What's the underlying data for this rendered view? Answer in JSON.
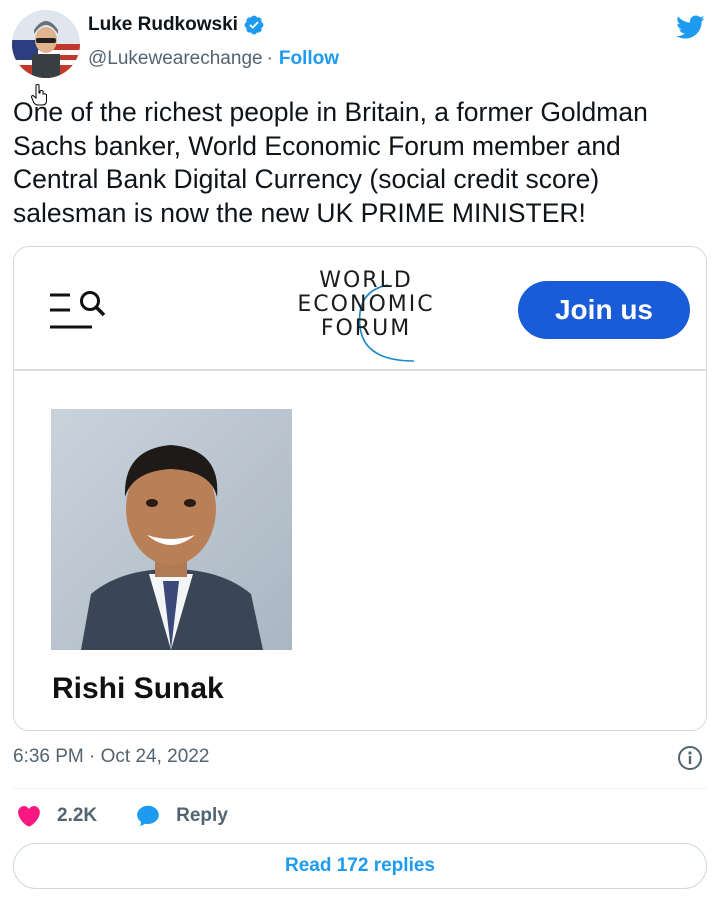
{
  "author": {
    "name": "Luke Rudkowski",
    "handle": "@Lukewearechange",
    "separator": "·",
    "follow_label": "Follow"
  },
  "tweet": {
    "text": "One of the richest people in Britain, a former Goldman Sachs banker, World Economic Forum member and Central Bank Digital Currency (social credit score) salesman is now the new UK PRIME MINISTER!",
    "timestamp": "6:36 PM · Oct 24, 2022"
  },
  "card": {
    "logo_lines": [
      "WORLD",
      "ECONOMIC",
      "FORUM"
    ],
    "join_label": "Join us",
    "person_name": "Rishi Sunak"
  },
  "actions": {
    "like_count": "2.2K",
    "reply_label": "Reply",
    "read_replies_label": "Read 172 replies"
  },
  "colors": {
    "accent": "#1d9bf0",
    "like": "#f91880",
    "join_button": "#1a5bd8",
    "muted_text": "#536471"
  },
  "icons": {
    "brand": "twitter-bird-icon",
    "verified": "verified-badge-icon",
    "menu": "menu-search-icon",
    "info": "info-icon",
    "like": "heart-icon",
    "reply": "speech-bubble-icon"
  }
}
